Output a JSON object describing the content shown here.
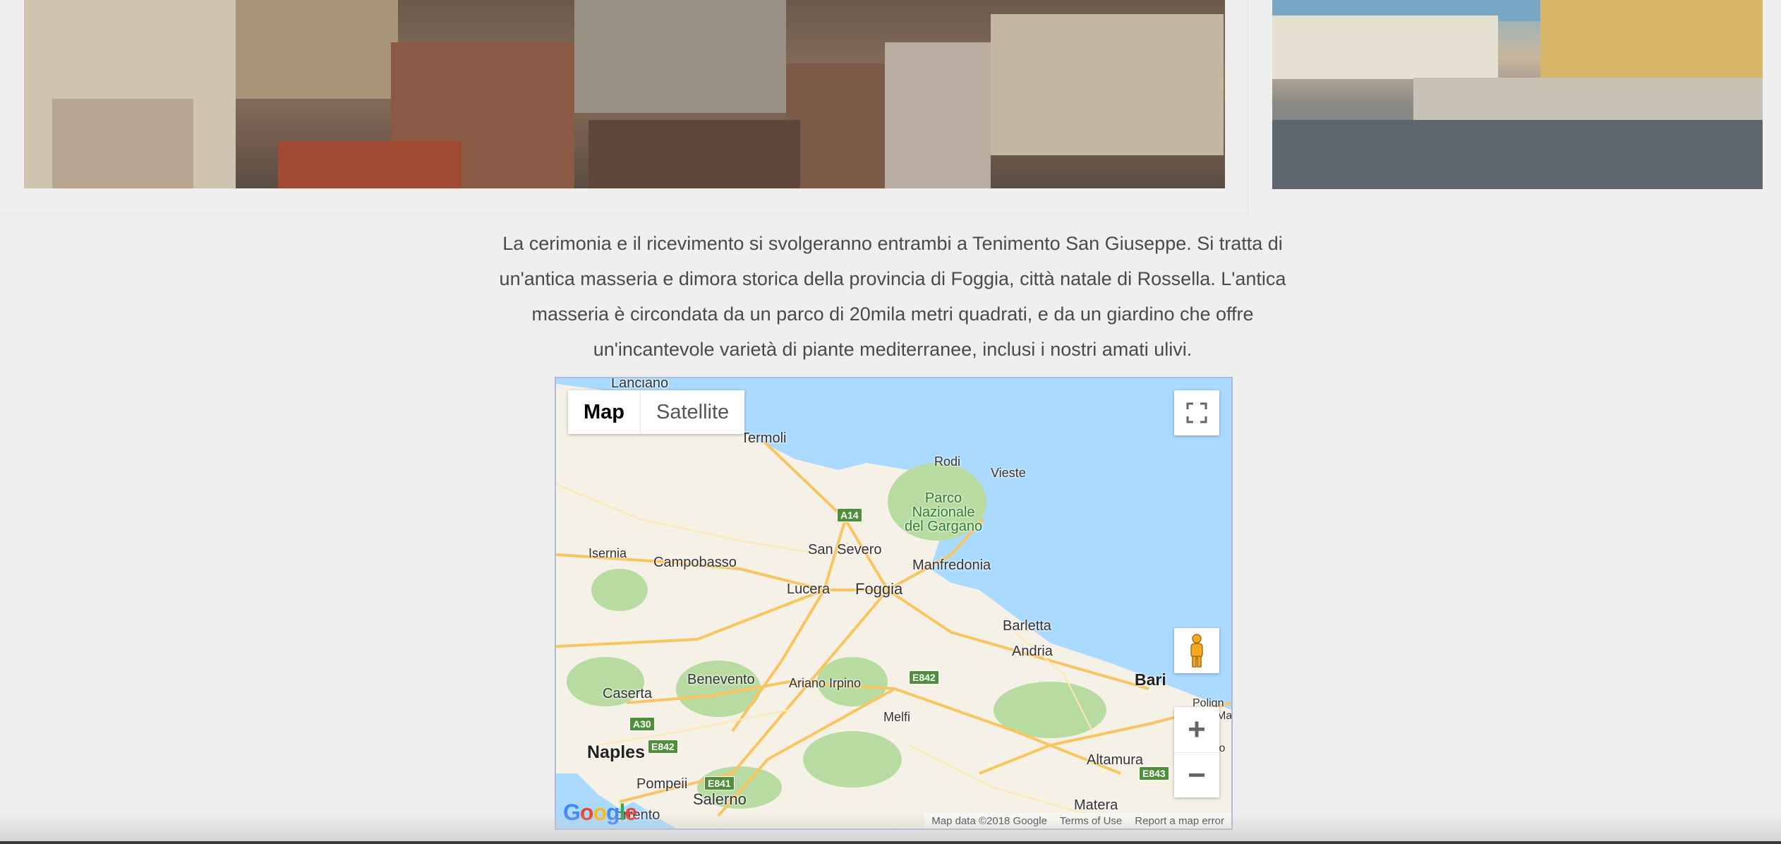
{
  "intro": {
    "paragraph": "La cerimonia e il ricevimento si svolgeranno entrambi a Tenimento San Giuseppe. Si tratta di un'antica masseria e dimora storica della provincia di Foggia, città natale di Rossella. L'antica masseria è circondata da un parco di 20mila metri quadrati, e da un giardino che offre un'incantevole varietà di piante mediterranee, inclusi i nostri amati ulivi."
  },
  "map": {
    "map_type": {
      "map_label": "Map",
      "satellite_label": "Satellite",
      "selected": "Map"
    },
    "places": {
      "lanciano": "Lanciano",
      "termoli": "Termoli",
      "rodi": "Rodi",
      "vieste": "Vieste",
      "park_line1": "Parco",
      "park_line2": "Nazionale",
      "park_line3": "del Gargano",
      "isernia": "Isernia",
      "campobasso": "Campobasso",
      "san_severo": "San Severo",
      "manfredonia": "Manfredonia",
      "lucera": "Lucera",
      "foggia": "Foggia",
      "barletta": "Barletta",
      "andria": "Andria",
      "bari": "Bari",
      "polignano": "Polign",
      "mo": "Ma",
      "benevento": "Benevento",
      "ariano": "Ariano Irpino",
      "caserta": "Caserta",
      "melfi": "Melfi",
      "naples": "Naples",
      "pompeii": "Pompeii",
      "salerno": "Salerno",
      "sorrento": "orrento",
      "altamura": "Altamura",
      "matera": "Matera",
      "edge": "lo"
    },
    "shields": {
      "a14": "A14",
      "e842_east": "E842",
      "a30": "A30",
      "e842_west": "E842",
      "e841": "E841",
      "e843": "E843"
    },
    "footer": {
      "map_data": "Map data ©2018 Google",
      "terms": "Terms of Use",
      "report": "Report a map error"
    },
    "google_logo": "Google",
    "zoom_in": "+",
    "zoom_out": "−"
  },
  "colors": {
    "background": "#efefef",
    "sea": "#aadaff",
    "land": "#f6f1e6",
    "road": "#f9c560",
    "park": "#b7dba0",
    "text": "#4a4a4a"
  }
}
